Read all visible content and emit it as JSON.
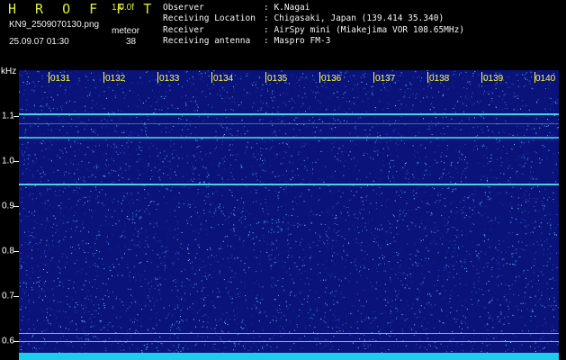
{
  "app": {
    "title": "H R O F F T",
    "version": "1.0.0f"
  },
  "file": {
    "name": "KN9_2509070130.png",
    "timestamp": "25.09.07 01:30"
  },
  "meteor": {
    "label": "meteor",
    "count": "38"
  },
  "info": [
    {
      "key": "Observer",
      "value": ": K.Nagai"
    },
    {
      "key": "Receiving Location",
      "value": ": Chigasaki, Japan (139.414 35.340)"
    },
    {
      "key": "Receiver",
      "value": ": AirSpy mini (Miakejima VOR 108.65MHz)"
    },
    {
      "key": "Receiving antenna",
      "value": ": Maspro FM-3"
    }
  ],
  "axis": {
    "unit": "kHz",
    "freq_labels": [
      "1.1",
      "1.0",
      "0.9",
      "0.8",
      "0.7",
      "0.6"
    ],
    "time_labels": [
      "0131",
      "0132",
      "0133",
      "0134",
      "0135",
      "0136",
      "0137",
      "0138",
      "0139",
      "0140"
    ]
  },
  "colors": {
    "title": "#dcee3a",
    "time_labels": "#ffff3a",
    "background": "#0a137a",
    "signal": "#1ad0e8"
  }
}
